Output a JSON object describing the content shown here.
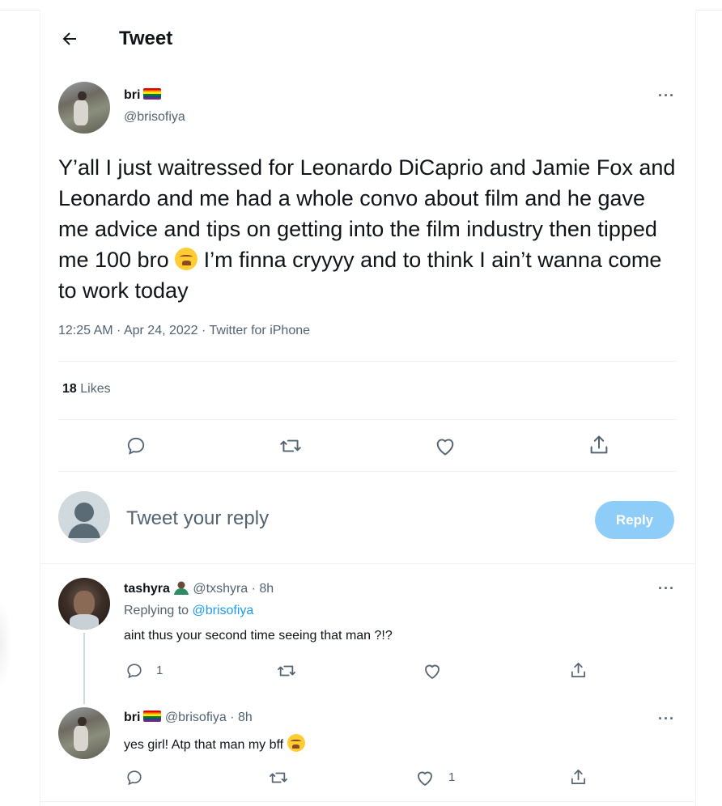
{
  "header": {
    "title": "Tweet"
  },
  "tweet": {
    "author_name": "bri",
    "author_handle": "@brisofiya",
    "text": "Y’all I just waitressed for Leonardo DiCaprio and Jamie Fox and Leonardo and me had a whole convo about film and he gave me advice and tips on getting into the film industry then tipped me 100 bro",
    "text_after_emoji": " I’m finna cryyyy and to think I ain’t wanna come to work today",
    "time": "12:25 AM",
    "date": "Apr 24, 2022",
    "source": "Twitter for iPhone",
    "separator": " · ",
    "likes_count": "18",
    "likes_label": "Likes"
  },
  "composer": {
    "placeholder": "Tweet your reply",
    "button": "Reply"
  },
  "replies": [
    {
      "name": "tashyra",
      "handle": "@txshyra",
      "time": "8h",
      "replying_label": "Replying to",
      "replying_handle": "@brisofiya",
      "text": "aint thus your second time seeing that man ?!?",
      "reply_count": "1",
      "like_count": ""
    },
    {
      "name": "bri",
      "handle": "@brisofiya",
      "time": "8h",
      "text": "yes girl! Atp that man my bff",
      "reply_count": "",
      "like_count": "1"
    }
  ],
  "icons": {
    "back": "arrow-left-icon",
    "more": "more-horizontal-icon",
    "reply": "speech-bubble-icon",
    "retweet": "retweet-icon",
    "like": "heart-icon",
    "share": "share-upload-icon",
    "flag": "rainbow-flag",
    "emoji_weary": "weary-face-emoji"
  },
  "colors": {
    "accent": "#1d9bf0",
    "reply_button": "#8ecdf8",
    "secondary_text": "#536471"
  }
}
